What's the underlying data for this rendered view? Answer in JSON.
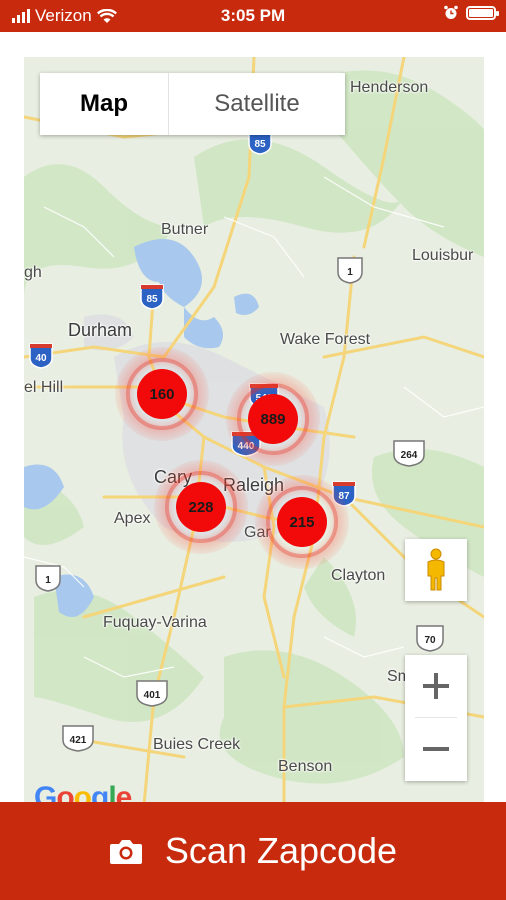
{
  "status_bar": {
    "carrier": "Verizon",
    "time": "3:05 PM",
    "battery_level": 1.0
  },
  "map": {
    "type_control": {
      "map_label": "Map",
      "satellite_label": "Satellite",
      "selected": "Map"
    },
    "places": {
      "henderson": "Henderson",
      "butner": "Butner",
      "durham": "Durham",
      "wake_forest": "Wake Forest",
      "louisburg": "Louisbur",
      "gh": "gh",
      "chapel_hill": "el Hill",
      "cary": "Cary",
      "raleigh": "Raleigh",
      "apex": "Apex",
      "garner": "Gar",
      "clayton": "Clayton",
      "fuquay_varina": "Fuquay-Varina",
      "buies_creek": "Buies Creek",
      "benson": "Benson",
      "smithfield": "Sm"
    },
    "shields": {
      "i85_top": "85",
      "i85_mid": "85",
      "i40": "40",
      "i540": "540",
      "i440": "440",
      "i87": "87",
      "us1_top": "1",
      "us1_left": "1",
      "us264": "264",
      "us70": "70",
      "us401": "401",
      "us421": "421"
    },
    "clusters": [
      {
        "name": "cluster-160",
        "count": "160"
      },
      {
        "name": "cluster-889",
        "count": "889"
      },
      {
        "name": "cluster-228",
        "count": "228"
      },
      {
        "name": "cluster-215",
        "count": "215"
      }
    ],
    "google_logo": "Google",
    "colors": {
      "cluster": "#f20a0a",
      "accent": "#c82a0d"
    }
  },
  "zoom": {
    "in": "+",
    "out": "−"
  },
  "scan_button": {
    "label": "Scan Zapcode"
  }
}
